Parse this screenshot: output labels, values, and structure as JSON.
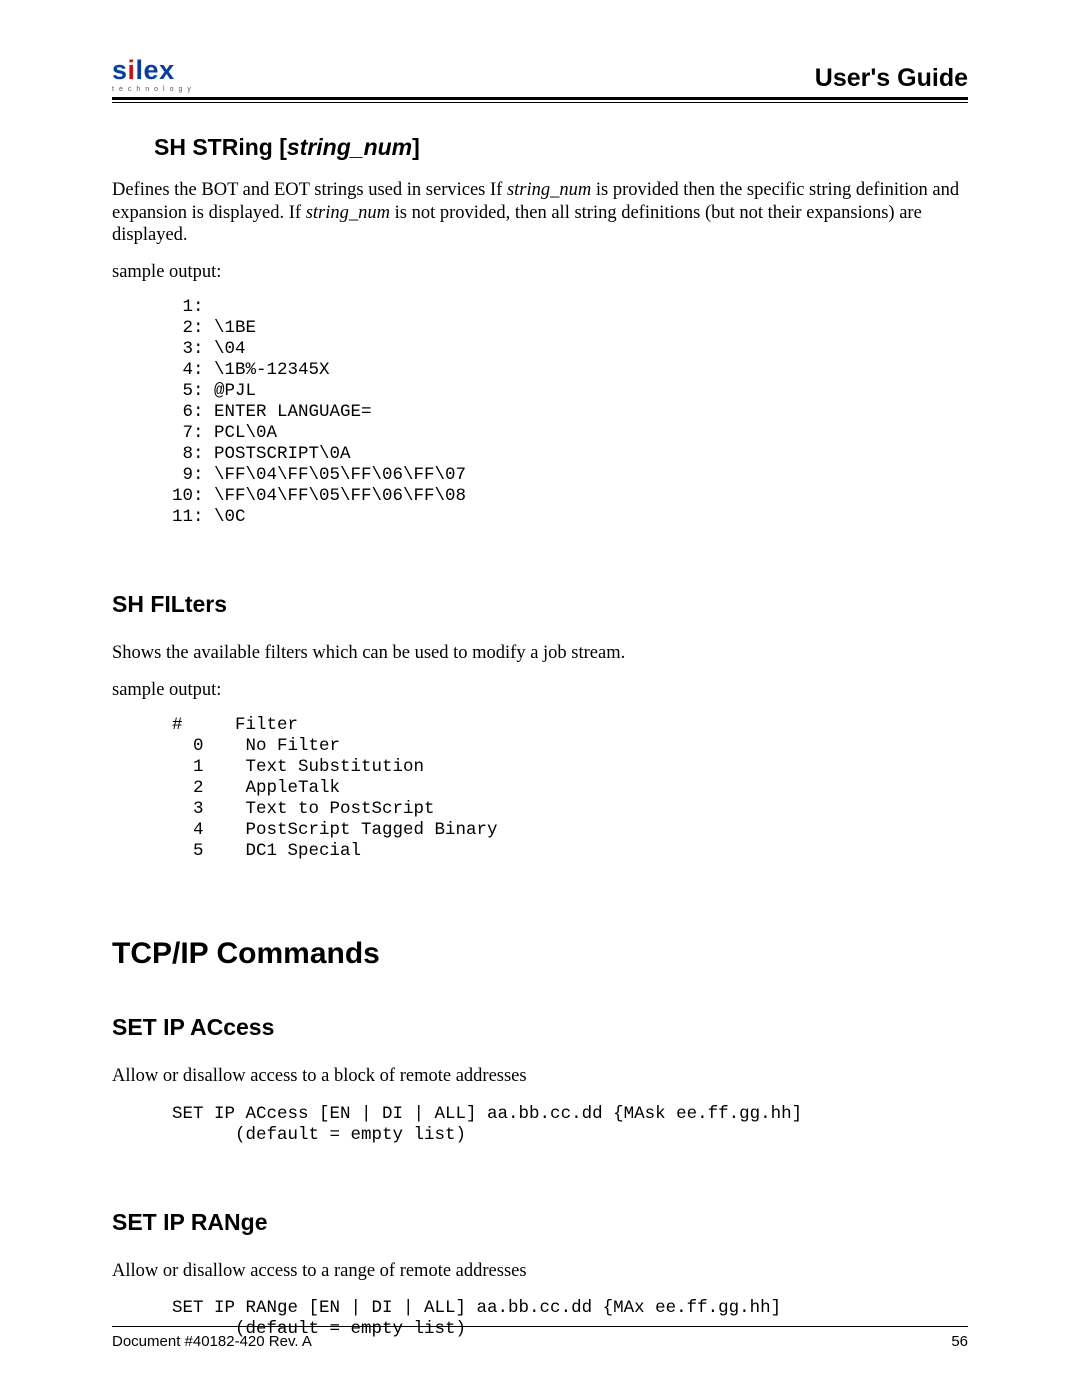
{
  "header": {
    "logo_brand_prefix": "s",
    "logo_brand_accent": "i",
    "logo_brand_suffix": "lex",
    "logo_sub": "technology",
    "guide_title": "User's Guide"
  },
  "sh_string": {
    "heading_prefix": "SH  STRing [",
    "heading_param": "string_num",
    "heading_suffix": "]",
    "body_pre": "Defines the BOT and EOT strings used in services  If ",
    "body_em1": "string_num",
    "body_mid": " is provided then the specific string definition and expansion is displayed.  If ",
    "body_em2": "string_num",
    "body_post": " is not provided, then all string definitions (but not their expansions) are displayed.",
    "sample_label": "sample output:",
    "sample": " 1:\n 2: \\1BE\n 3: \\04\n 4: \\1B%-12345X\n 5: @PJL\n 6: ENTER LANGUAGE=\n 7: PCL\\0A\n 8: POSTSCRIPT\\0A\n 9: \\FF\\04\\FF\\05\\FF\\06\\FF\\07\n10: \\FF\\04\\FF\\05\\FF\\06\\FF\\08\n11: \\0C"
  },
  "sh_filters": {
    "heading": "SH  FILters",
    "body": "Shows the available filters which can be used to modify a job stream.",
    "sample_label": "sample output:",
    "sample": "#     Filter\n  0    No Filter\n  1    Text Substitution\n  2    AppleTalk\n  3    Text to PostScript\n  4    PostScript Tagged Binary\n  5    DC1 Special"
  },
  "tcpip": {
    "chapter": "TCP/IP Commands"
  },
  "set_ip_access": {
    "heading": "SET IP ACcess",
    "body": "Allow or disallow access to a block of remote addresses",
    "code": "SET IP ACcess [EN | DI | ALL] aa.bb.cc.dd {MAsk ee.ff.gg.hh]\n      (default = empty list)"
  },
  "set_ip_range": {
    "heading": "SET IP RANge",
    "body": "Allow or disallow access to a range of remote addresses",
    "code": "SET IP RANge [EN | DI | ALL] aa.bb.cc.dd {MAx ee.ff.gg.hh]\n      (default = empty list)"
  },
  "footer": {
    "doc_id": "Document #40182-420  Rev. A",
    "page_num": "56"
  }
}
